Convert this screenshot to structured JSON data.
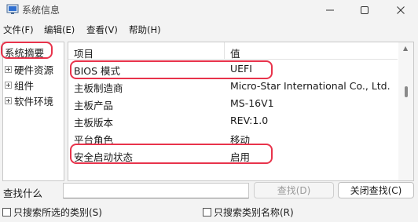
{
  "window": {
    "title": "系统信息"
  },
  "menu": {
    "file": "文件(F)",
    "edit": "编辑(E)",
    "view": "查看(V)",
    "help": "帮助(H)"
  },
  "tree": {
    "root": "系统摘要",
    "items": [
      {
        "label": "硬件资源"
      },
      {
        "label": "组件"
      },
      {
        "label": "软件环境"
      }
    ]
  },
  "table": {
    "headers": {
      "item": "项目",
      "value": "值"
    },
    "rows": [
      {
        "item": "BIOS 模式",
        "value": "UEFI"
      },
      {
        "item": "主板制造商",
        "value": "Micro-Star International Co., Ltd."
      },
      {
        "item": "主板产品",
        "value": "MS-16V1"
      },
      {
        "item": "主板版本",
        "value": "REV:1.0"
      },
      {
        "item": "平台角色",
        "value": "移动"
      },
      {
        "item": "安全启动状态",
        "value": "启用"
      }
    ]
  },
  "search": {
    "label": "查找什么",
    "value": "",
    "find_button": "查找(D)",
    "close_button": "关闭查找(C)",
    "option_selected_category": "只搜索所选的类别(S)",
    "option_category_names": "只搜索类别名称(R)"
  },
  "colors": {
    "highlight": "#e8334b"
  }
}
